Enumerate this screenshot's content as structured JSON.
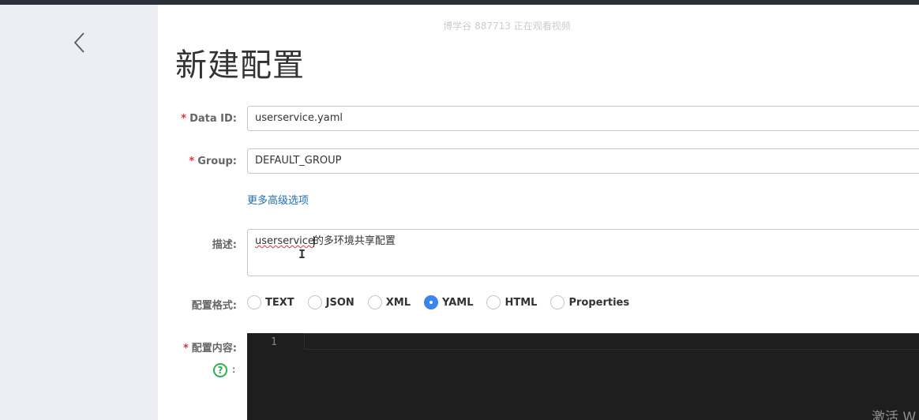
{
  "watermark": "博学谷 887713 正在观看视频",
  "page_title": "新建配置",
  "form": {
    "data_id": {
      "label": "Data ID:",
      "value": "userservice.yaml"
    },
    "group": {
      "label": "Group:",
      "value": "DEFAULT_GROUP"
    },
    "advanced_link": "更多高级选项",
    "description": {
      "label": "描述:",
      "value_misspelled": "userservice",
      "value_rest": "的多环境共享配置"
    },
    "format": {
      "label": "配置格式:",
      "options": [
        "TEXT",
        "JSON",
        "XML",
        "YAML",
        "HTML",
        "Properties"
      ],
      "selected": "YAML"
    },
    "content": {
      "label": "配置内容:",
      "help_colon": ":",
      "line_numbers": [
        "1"
      ]
    }
  },
  "icons": {
    "back": "chevron-left-icon",
    "help": "question-circle-icon",
    "help_color": "#2bb24c"
  },
  "colors": {
    "accent": "#3b85f0",
    "required": "#e0303a",
    "link": "#1f6fb5",
    "editor_bg": "#1e1e1e"
  },
  "os_overlay": "激活 W"
}
